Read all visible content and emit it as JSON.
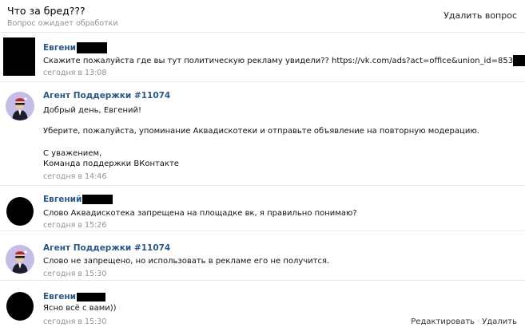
{
  "question": {
    "title": "Что за бред???",
    "status": "Вопрос ожидает обработки",
    "delete_label": "Удалить вопрос"
  },
  "messages": [
    {
      "author": "Евгени",
      "lines": [
        "Скажите пожалуйста где вы тут политическую рекламу увидели?? https://vk.com/ads?act=office&union_id=853"
      ],
      "time": "сегодня в 13:08"
    },
    {
      "author": "Агент Поддержки #11074",
      "lines": [
        "Добрый день, Евгений!",
        "Уберите, пожалуйста, упоминание Аквадискотеки и отправьте объявление на повторную модерацию.",
        "С уважением,",
        "Команда поддержки ВКонтакте"
      ],
      "time": "сегодня в 14:46"
    },
    {
      "author": "Евгений",
      "lines": [
        "Слово Аквадискотека запрещена на площадке вк, я правильно понимаю?"
      ],
      "time": "сегодня в 15:26"
    },
    {
      "author": "Агент Поддержки #11074",
      "lines": [
        "Слово не запрещено, но использовать в рекламе его не получится."
      ],
      "time": "сегодня в 15:30"
    },
    {
      "author": "Евгени",
      "lines": [
        "Ясно всё с вами))"
      ],
      "time": "сегодня в 15:30",
      "edit_label": "Редактировать",
      "delete_label": "Удалить"
    }
  ]
}
